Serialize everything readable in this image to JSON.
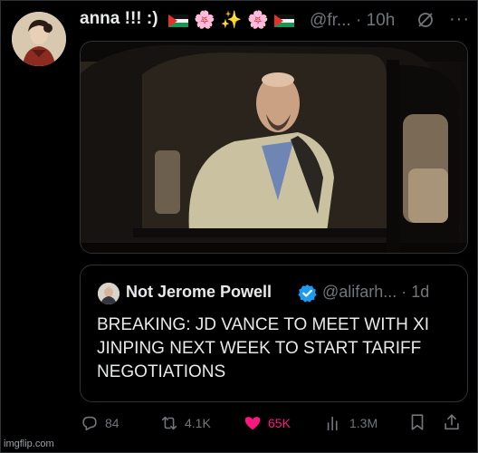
{
  "tweet": {
    "author_name": "anna !!! :)",
    "author_emojis": [
      "flag",
      "🌸",
      "✨",
      "🌸",
      "flag"
    ],
    "author_handle_time": "@fr... · 10h"
  },
  "quoted_tweet": {
    "author_name": "Not Jerome Powell",
    "author_handle_time": "@alifarh... · 1d",
    "text": "BREAKING: JD VANCE TO MEET WITH XI JINPING NEXT WEEK TO START TARIFF NEGOTIATIONS"
  },
  "actions": {
    "replies": "84",
    "reposts": "4.1K",
    "likes": "65K",
    "views": "1.3M"
  },
  "colors": {
    "background": "#000000",
    "text": "#e7e9ea",
    "muted": "#71767b",
    "like": "#f91880",
    "verified": "#1d9bf0"
  },
  "watermark": "imgflip.com"
}
